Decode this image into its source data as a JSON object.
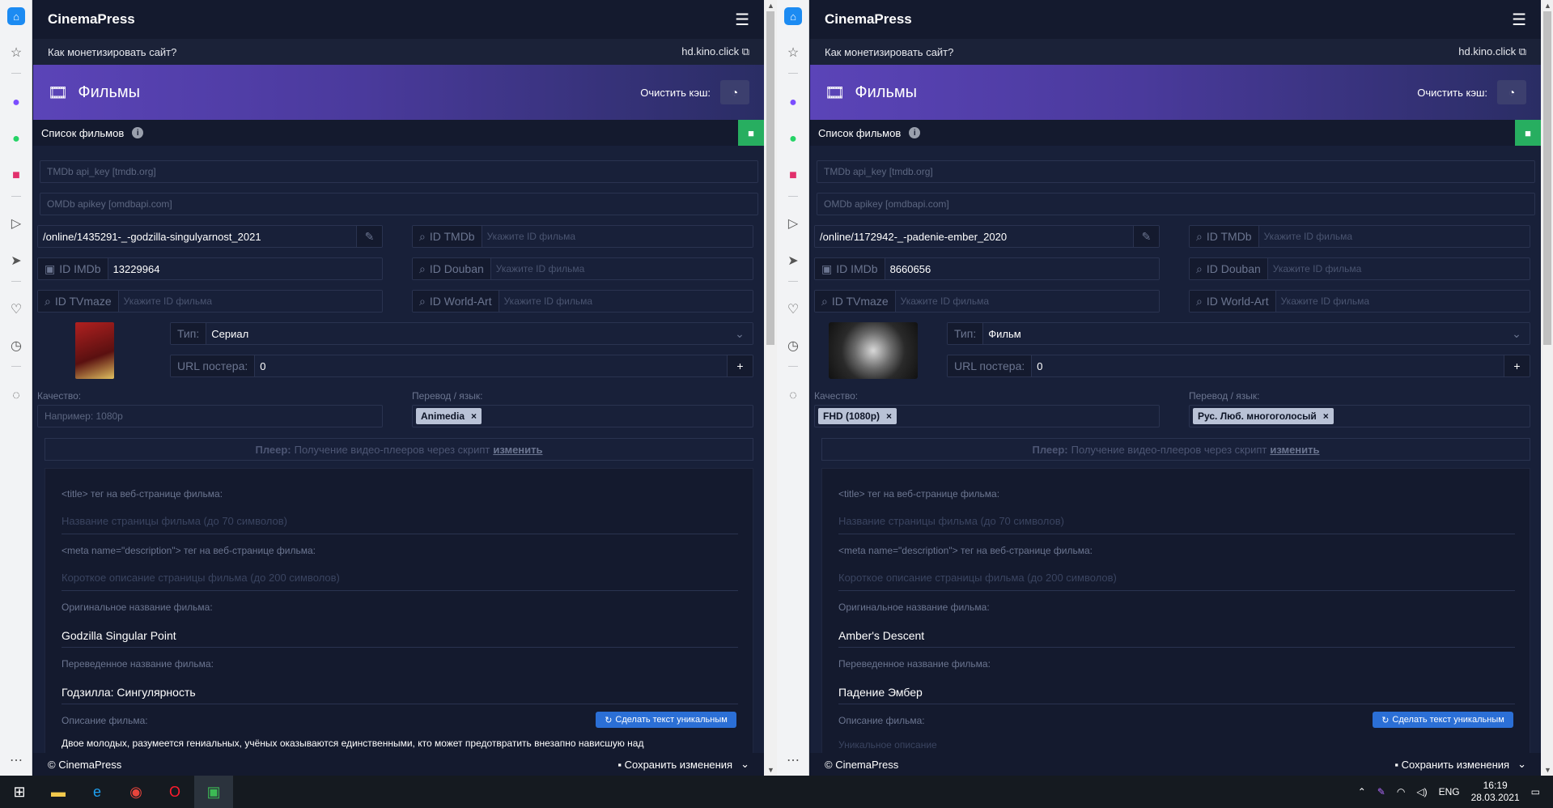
{
  "app": {
    "brand": "CinemaPress",
    "monetize": "Как монетизировать сайт?",
    "domain": "hd.kino.click",
    "section": "Фильмы",
    "clear_cache": "Очистить кэш:",
    "list_label": "Список фильмов",
    "footer_copy": "© CinemaPress",
    "save": "Сохранить изменения"
  },
  "labels": {
    "tmdb_key_ph": "TMDb api_key [tmdb.org]",
    "omdb_key_ph": "OMDb apikey [omdbapi.com]",
    "id_tmdb": "ID TMDb",
    "id_imdb": "ID IMDb",
    "id_douban": "ID Douban",
    "id_tvmaze": "ID TVmaze",
    "id_worldart": "ID World-Art",
    "id_ph": "Укажите ID фильма",
    "type": "Тип:",
    "poster_url": "URL постера:",
    "quality": "Качество:",
    "quality_ph": "Например: 1080p",
    "translate": "Перевод / язык:",
    "player_b": "Плеер:",
    "player_t": "Получение видео-плееров через скрипт",
    "player_link": "изменить",
    "title_tag": "<title> тег на веб-странице фильма:",
    "title_ph": "Название страницы фильма (до 70 символов)",
    "desc_tag": "<meta name=\"description\"> тег на веб-странице фильма:",
    "desc_ph": "Короткое описание страницы фильма (до 200 символов)",
    "orig_name": "Оригинальное название фильма:",
    "trans_name": "Переведенное название фильма:",
    "film_desc": "Описание фильма:",
    "uniq_btn": "Сделать текст уникальным"
  },
  "left": {
    "url": "/online/1435291-_-godzilla-singulyarnost_2021",
    "imdb": "13229964",
    "type": "Сериал",
    "poster_url": "0",
    "translation": "Animedia",
    "orig": "Godzilla Singular Point",
    "trans": "Годзилла: Сингулярность",
    "desc": "Двое молодых, разумеется гениальных, учёных оказываются единственными, кто может предотвратить внезапно нависшую над"
  },
  "right": {
    "url": "/online/1172942-_-padenie-ember_2020",
    "imdb": "8660656",
    "type": "Фильм",
    "poster_url": "0",
    "quality": "FHD (1080p)",
    "translation": "Рус. Люб. многоголосый",
    "orig": "Amber's Descent",
    "trans": "Падение Эмбер",
    "uniq_ph": "Уникальное описание"
  },
  "taskbar": {
    "lang": "ENG",
    "time": "16:19",
    "date": "28.03.2021"
  }
}
